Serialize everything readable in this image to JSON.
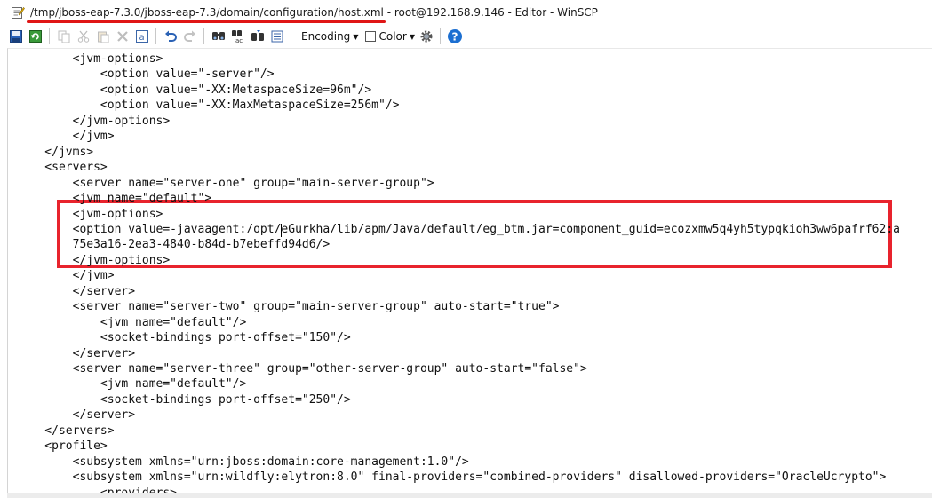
{
  "window": {
    "title_path": "/tmp/jboss-eap-7.3.0/jboss-eap-7.3/domain/configuration/host.xml",
    "title_rest": " - root@192.168.9.146 - Editor - WinSCP"
  },
  "toolbar": {
    "encoding_label": "Encoding",
    "color_label": "Color"
  },
  "colors": {
    "annotation_red": "#e8232d",
    "help_blue": "#1c6fd1"
  },
  "editor": {
    "lines": [
      "        <jvm-options>",
      "            <option value=\"-server\"/>",
      "            <option value=\"-XX:MetaspaceSize=96m\"/>",
      "            <option value=\"-XX:MaxMetaspaceSize=256m\"/>",
      "        </jvm-options>",
      "        </jvm>",
      "    </jvms>",
      "    <servers>",
      "        <server name=\"server-one\" group=\"main-server-group\">",
      "        <jvm name=\"default\">",
      "        <jvm-options>",
      "        <option value=-javaagent:/opt/eGurkha/lib/apm/Java/default/eg_btm.jar=component_guid=ecozxmw5q4yh5typqkioh3ww6pafrf62:a",
      "        75e3a16-2ea3-4840-b84d-b7ebeffd94d6/>",
      "        </jvm-options>",
      "        </jvm>",
      "        </server>",
      "        <server name=\"server-two\" group=\"main-server-group\" auto-start=\"true\">",
      "            <jvm name=\"default\"/>",
      "            <socket-bindings port-offset=\"150\"/>",
      "        </server>",
      "        <server name=\"server-three\" group=\"other-server-group\" auto-start=\"false\">",
      "            <jvm name=\"default\"/>",
      "            <socket-bindings port-offset=\"250\"/>",
      "        </server>",
      "    </servers>",
      "    <profile>",
      "        <subsystem xmlns=\"urn:jboss:domain:core-management:1.0\"/>",
      "        <subsystem xmlns=\"urn:wildfly:elytron:8.0\" final-providers=\"combined-providers\" disallowed-providers=\"OracleUcrypto\">",
      "            <providers>"
    ]
  }
}
